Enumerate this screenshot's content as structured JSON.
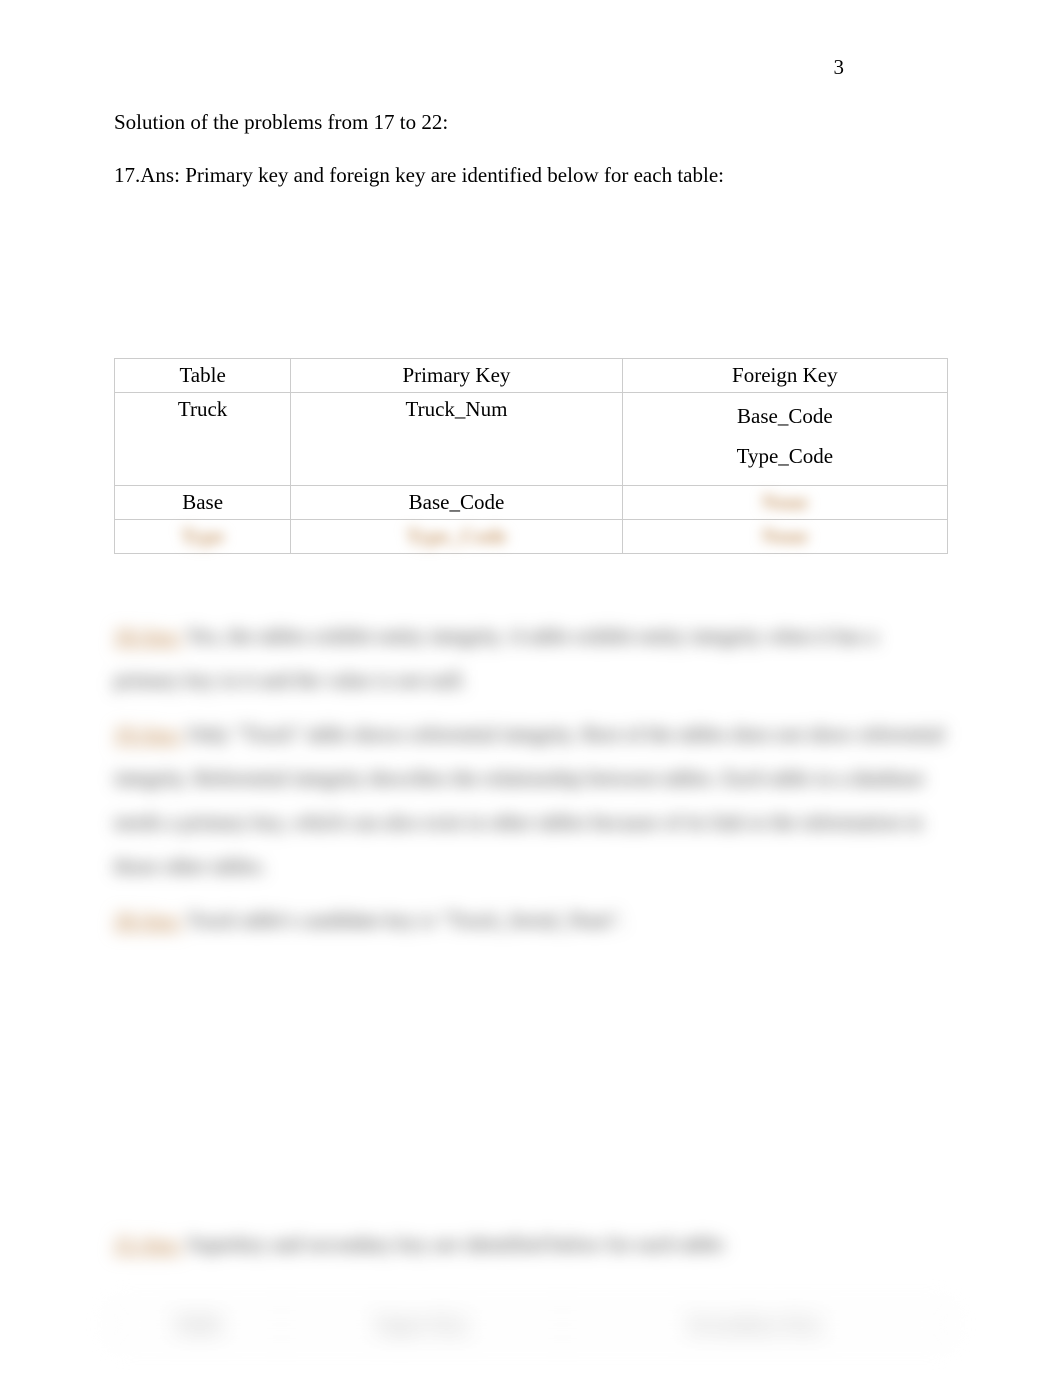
{
  "page_number": "3",
  "heading": "Solution of the problems from 17 to 22:",
  "answer_intro": {
    "label": "17.Ans:",
    "text": "Primary key and foreign key are identified below for each table:"
  },
  "table1": {
    "headers": [
      "Table",
      "Primary Key",
      "Foreign Key"
    ],
    "rows": [
      {
        "table": "Truck",
        "pk": "Truck_Num",
        "fk": [
          "Base_Code",
          "Type_Code"
        ]
      },
      {
        "table": "Base",
        "pk": "Base_Code",
        "fk": [
          "None"
        ]
      },
      {
        "table": "Type",
        "pk": "Type_Code",
        "fk": [
          "None"
        ]
      }
    ]
  },
  "blurred_paragraphs": [
    {
      "num": "18.Ans:",
      "text": "Yes, the tables exhibit entity integrity. A table exhibit entity integrity when it has a primary key in it and the value is not null."
    },
    {
      "num": "19.Ans:",
      "text": "Only \"Truck\" table shows referential integrity. Rest of the tables does not show referential integrity. Referential integrity describes the relationship between tables. Each table in a database needs a primary key, which can also exist in other tables because of its link to the information in those other tables."
    },
    {
      "num": "20.Ans:",
      "text": "Truck table's candidate key is \"Truck_Serial_Num\"."
    }
  ],
  "blurred_line_21": {
    "num": "21.Ans:",
    "text": "Superkey and secondary key are identified below for each table:"
  },
  "table2": {
    "headers": [
      "Table",
      "Super Key",
      "Secondary Key"
    ]
  }
}
